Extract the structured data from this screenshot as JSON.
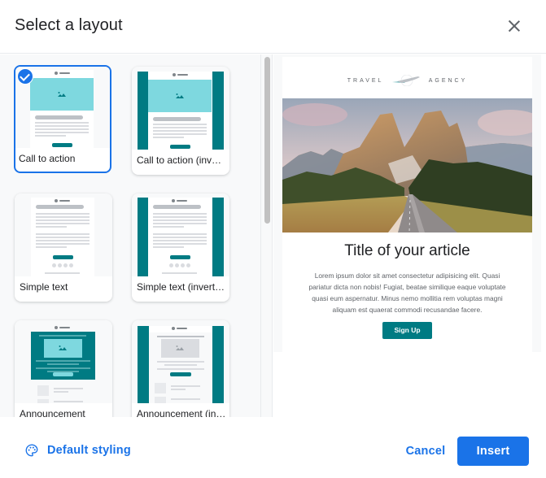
{
  "dialog": {
    "title": "Select a layout",
    "close_icon": "close-icon"
  },
  "layouts": [
    {
      "label": "Call to action",
      "selected": true,
      "variant": "cta"
    },
    {
      "label": "Call to action (inverted)",
      "selected": false,
      "variant": "cta-inverted"
    },
    {
      "label": "Simple text",
      "selected": false,
      "variant": "simple"
    },
    {
      "label": "Simple text (inverted)",
      "selected": false,
      "variant": "simple-inverted"
    },
    {
      "label": "Announcement",
      "selected": false,
      "variant": "announcement"
    },
    {
      "label": "Announcement (inverted)",
      "selected": false,
      "variant": "announcement-inverted"
    }
  ],
  "preview": {
    "logo_left": "TRAVEL",
    "logo_right": "AGENCY",
    "image_alt": "Mountain road with rocky peaks and forest",
    "article_title": "Title of your article",
    "article_body": "Lorem ipsum dolor sit amet consectetur adipisicing elit. Quasi pariatur dicta non nobis! Fugiat, beatae similique eaque voluptate quasi eum aspernatur. Minus nemo mollitia rem voluptas magni aliquam est quaerat commodi recusandae facere.",
    "cta_label": "Sign Up"
  },
  "footer": {
    "default_styling_label": "Default styling",
    "cancel_label": "Cancel",
    "insert_label": "Insert"
  },
  "colors": {
    "accent": "#1a73e8",
    "teal": "#007b83",
    "light_teal": "#7ed8df"
  }
}
